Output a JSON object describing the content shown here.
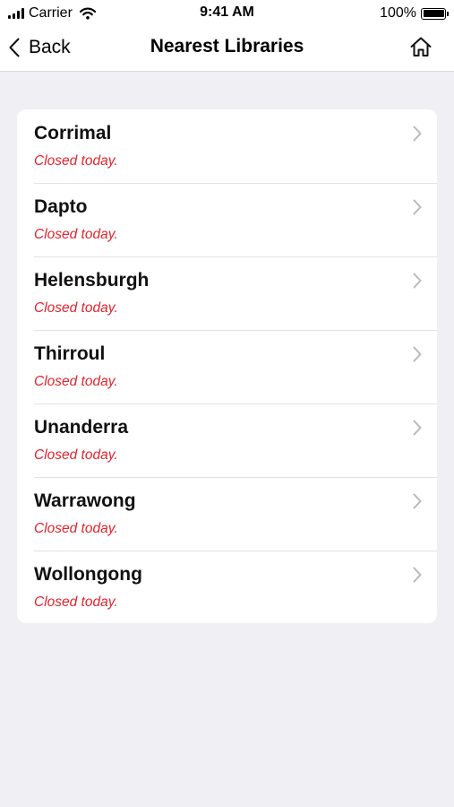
{
  "status_bar": {
    "carrier": "Carrier",
    "time": "9:41 AM",
    "battery": "100%"
  },
  "nav": {
    "back_label": "Back",
    "title": "Nearest Libraries",
    "home_icon": "home-icon"
  },
  "libraries": [
    {
      "name": "Corrimal",
      "status": "Closed today."
    },
    {
      "name": "Dapto",
      "status": "Closed today."
    },
    {
      "name": "Helensburgh",
      "status": "Closed today."
    },
    {
      "name": "Thirroul",
      "status": "Closed today."
    },
    {
      "name": "Unanderra",
      "status": "Closed today."
    },
    {
      "name": "Warrawong",
      "status": "Closed today."
    },
    {
      "name": "Wollongong",
      "status": "Closed today."
    }
  ],
  "colors": {
    "status_closed": "#e3232d",
    "background": "#efeff4",
    "card": "#ffffff"
  }
}
